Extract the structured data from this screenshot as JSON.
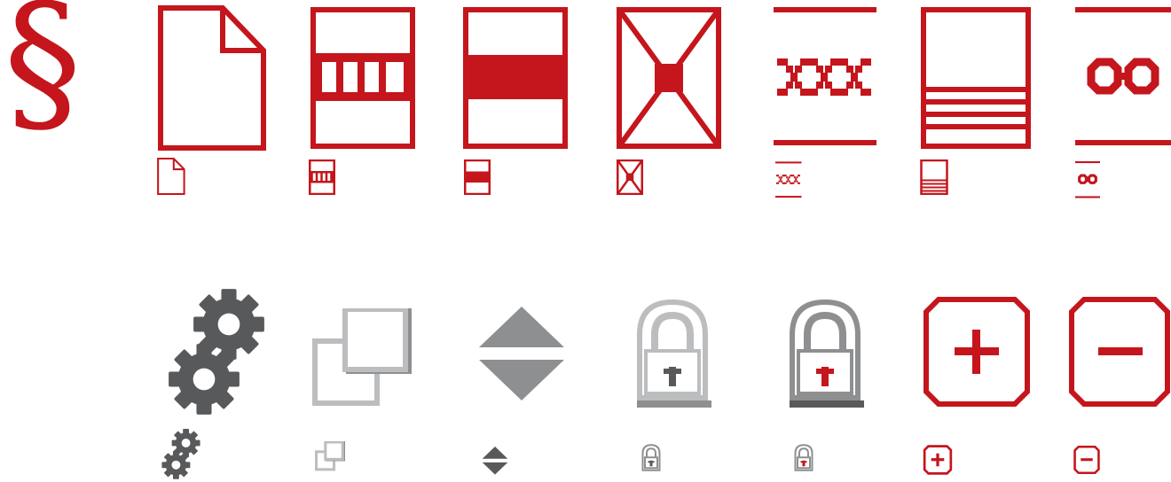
{
  "symbol": {
    "text": "§"
  },
  "colors": {
    "red": "#c4161c",
    "dark_gray": "#58595b",
    "mid_gray": "#8e8f91",
    "light_gray": "#bcbdbf",
    "white": "#ffffff"
  },
  "icons_row1": [
    "document-icon",
    "toolbar-frame-icon",
    "center-band-icon",
    "crossed-frame-icon",
    "chain-rule-icon",
    "lined-frame-icon",
    "infinity-rule-icon"
  ],
  "icons_row2": [
    "gears-icon",
    "overlapping-squares-icon",
    "up-down-arrows-icon",
    "lock-gray-icon",
    "lock-red-icon",
    "plus-icon",
    "minus-icon"
  ]
}
